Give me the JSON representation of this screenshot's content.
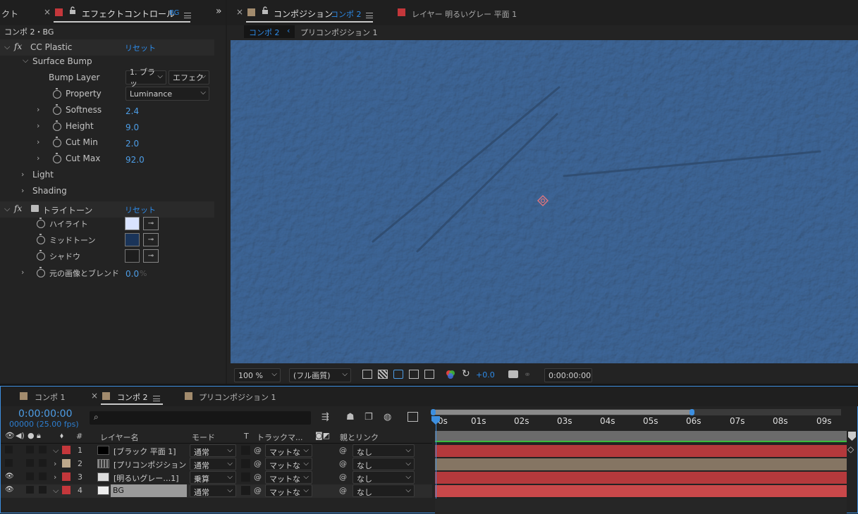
{
  "left_panel": {
    "clip_tab": "クト",
    "tab_title": "エフェクトコントロール",
    "tab_layer": "BG",
    "breadcrumb": "コンポ 2・BG",
    "effects": [
      {
        "name": "CC Plastic",
        "reset": "リセット"
      },
      {
        "name": "トライトーン",
        "reset": "リセット"
      }
    ],
    "surface_bump": "Surface Bump",
    "bump_layer": {
      "label": "Bump Layer",
      "layer_value": "1. ブラッ",
      "source_value": "エフェク"
    },
    "property": {
      "label": "Property",
      "value": "Luminance"
    },
    "params": [
      {
        "label": "Softness",
        "value": "2.4"
      },
      {
        "label": "Height",
        "value": "9.0"
      },
      {
        "label": "Cut Min",
        "value": "2.0"
      },
      {
        "label": "Cut Max",
        "value": "92.0"
      }
    ],
    "groups": [
      "Light",
      "Shading"
    ],
    "tritone": [
      {
        "label": "ハイライト",
        "color": "#d9e3ff"
      },
      {
        "label": "ミッドトーン",
        "color": "#1a3459"
      },
      {
        "label": "シャドウ",
        "color": "#1d1d1d"
      }
    ],
    "blend": {
      "label": "元の画像とブレンド",
      "value": "0.0",
      "unit": "%"
    }
  },
  "comp_panel": {
    "tab_label": "コンポジション",
    "tab_comp": "コンポ 2",
    "layer_tab": "レイヤー 明るいグレー 平面 1",
    "breadcrumbs": [
      "コンポ 2",
      "プリコンポジション 1"
    ],
    "viewer_color": "#4f76a0",
    "toolbar": {
      "zoom": "100 %",
      "quality": "(フル画質)",
      "exposure": "+0.0",
      "timecode": "0:00:00:00"
    }
  },
  "timeline": {
    "tabs": [
      {
        "label": "コンポ 1",
        "color": "#a28b6d"
      },
      {
        "label": "コンポ 2",
        "color": "#a28b6d"
      },
      {
        "label": "プリコンポジション 1",
        "color": "#a28b6d"
      }
    ],
    "timecode": "0:00:00:00",
    "frames": "00000 (25.00 fps)",
    "search_placeholder": "",
    "headers": {
      "num": "#",
      "name": "レイヤー名",
      "mode": "モード",
      "t": "T",
      "track": "トラックマ...",
      "parent": "親とリンク"
    },
    "ruler": [
      "0s",
      "01s",
      "02s",
      "03s",
      "04s",
      "05s",
      "06s",
      "07s",
      "08s",
      "09s"
    ],
    "layers": [
      {
        "num": "1",
        "name": "[ブラック 平面 1]",
        "mode": "通常",
        "track": "マットな",
        "parent": "なし",
        "label_color": "#c4373b",
        "bar_color": "#b5393c",
        "visible": false
      },
      {
        "num": "2",
        "name": "[プリコンポジション 1]",
        "mode": "通常",
        "track": "マットな",
        "parent": "なし",
        "label_color": "#bda88b",
        "bar_color": "#857563",
        "visible": false
      },
      {
        "num": "3",
        "name": "[明るいグレー…1]",
        "mode": "乗算",
        "track": "マットな",
        "parent": "なし",
        "label_color": "#c4373b",
        "bar_color": "#b5393c",
        "visible": true
      },
      {
        "num": "4",
        "name": "BG",
        "mode": "通常",
        "track": "マットな",
        "parent": "なし",
        "label_color": "#c4373b",
        "bar_color": "#c9484a",
        "visible": true
      }
    ]
  }
}
